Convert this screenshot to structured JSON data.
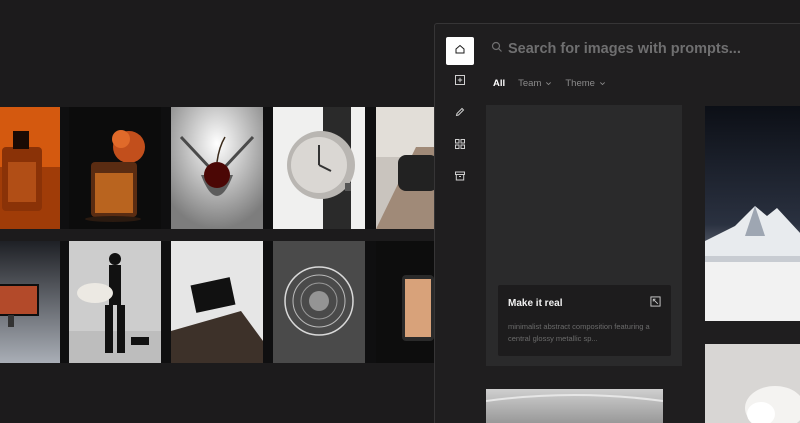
{
  "sidebar": {
    "items": [
      {
        "name": "home",
        "icon": "home-icon"
      },
      {
        "name": "new",
        "icon": "plus-square-icon"
      },
      {
        "name": "edit",
        "icon": "pencil-icon"
      },
      {
        "name": "apps",
        "icon": "grid-icon"
      },
      {
        "name": "archive",
        "icon": "archive-icon"
      }
    ]
  },
  "search": {
    "placeholder": "Search for images with prompts..."
  },
  "filters": {
    "all": "All",
    "team": "Team",
    "theme": "Theme"
  },
  "prompt_card": {
    "title": "Make it real",
    "description": "minimalist abstract composition featuring a central glossy metallic sp..."
  },
  "colors": {
    "background": "#1c1b1c",
    "panel": "#1f1e1f",
    "card": "#2a2a2b",
    "accent_active": "#ffffff"
  }
}
